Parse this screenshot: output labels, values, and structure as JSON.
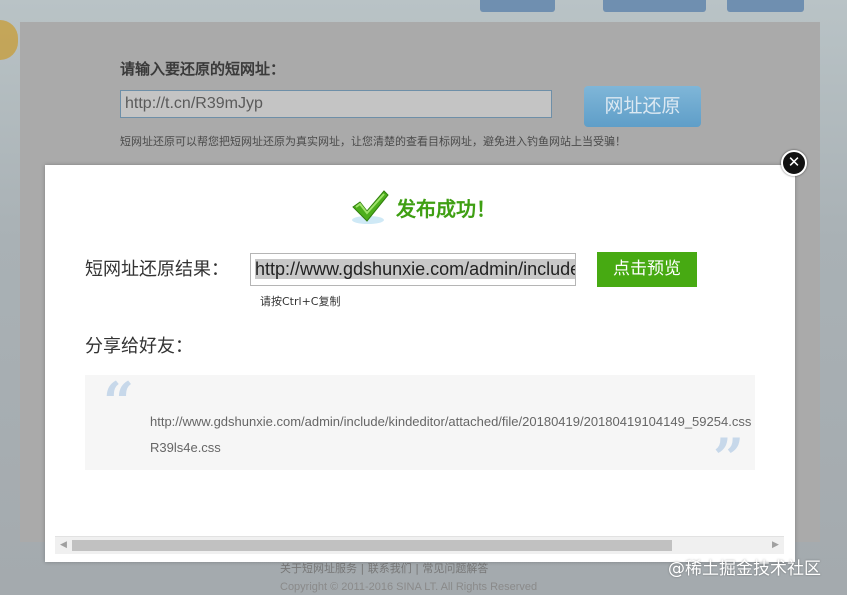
{
  "background": {
    "prompt": "请输入要还原的短网址：",
    "short_url_value": "http://t.cn/R39mJyp",
    "restore_button": "网址还原",
    "description": "短网址还原可以帮您把短网址还原为真实网址，让您清楚的查看目标网址，避免进入钓鱼网站上当受骗！",
    "footer_links": "关于短网址服务  |  联系我们  |  常见问题解答",
    "copyright": "Copyright © 2011-2016 SINA LT. All Rights Reserved"
  },
  "modal": {
    "close_icon": "✕",
    "success_icon": "checkmark-icon",
    "success_text": "发布成功！",
    "result_label": "短网址还原结果：",
    "result_value": "http://www.gdshunxie.com/admin/include/kindeditor/attached/file/20180419/20180419104149_59254.css",
    "copy_hint": "请按Ctrl+C复制",
    "preview_button": "点击预览",
    "share_label": "分享给好友：",
    "share_line1": "http://www.gdshunxie.com/admin/include/kindeditor/attached/file/20180419/20180419104149_59254.css",
    "share_line2": "R39ls4e.css",
    "quote_open": "“",
    "quote_close": "”"
  },
  "scrollbar": {
    "left_arrow": "◀",
    "right_arrow": "▶"
  },
  "watermark": "@稀土掘金技术社区",
  "colors": {
    "success_green": "#3f9f13",
    "button_green": "#47aa12",
    "quote_blue": "#c7d8ea"
  }
}
